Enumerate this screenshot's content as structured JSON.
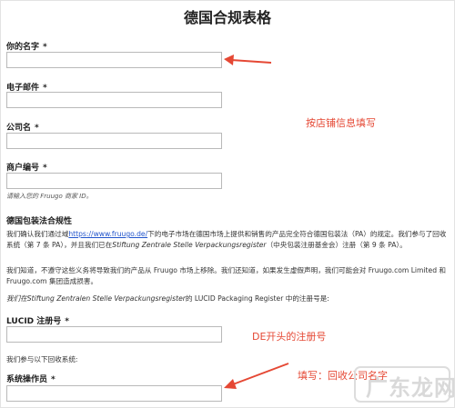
{
  "form": {
    "title": "德国合规表格",
    "required_mark": "*",
    "fields": [
      {
        "label": "你的名字",
        "value": ""
      },
      {
        "label": "电子邮件",
        "value": ""
      },
      {
        "label": "公司名",
        "value": ""
      },
      {
        "label": "商户编号",
        "value": ""
      }
    ],
    "merchant_hint": "请输入您的 Fruugo 商家 ID。",
    "section_title": "德国包装法合规性",
    "para1": {
      "a": "我们确认我们通过域",
      "link": "https://www.fruugo.de/",
      "b": "下的电子市场在德国市场上提供和销售的产品完全符合德国包装法（PA）的规定。我们参与了回收系统（第 7 条 PA），并且我们已在",
      "italic": "Stiftung Zentrale Stelle Verpackungsregister",
      "c": "（中央包装注册基金会）注册（第 9 条 PA）。"
    },
    "para2": "我们知道，不遵守这些义务将导致我们的产品从 Fruugo 市场上移除。我们还知道，如果发生虚假声明，我们可能会对 Fruugo.com Limited 和 Fruugo.com 集团造成损害。",
    "para3": {
      "a": "我们在",
      "italic": "Stiftung Zentralen Stelle Verpackungsregister",
      "b": "的 LUCID Packaging Register 中的注册号是:"
    },
    "lucid_label": "LUCID 注册号",
    "lucid_value": "",
    "recycle_text": "我们参与以下回收系统:",
    "operator_label": "系统操作员",
    "operator_value": ""
  },
  "annotations": {
    "store_info": "按店铺信息填写",
    "de_prefix": "DE开头的注册号",
    "recycle_company": "填写：回收公司名字",
    "color": "#e54834"
  },
  "watermark": "广东龙网"
}
